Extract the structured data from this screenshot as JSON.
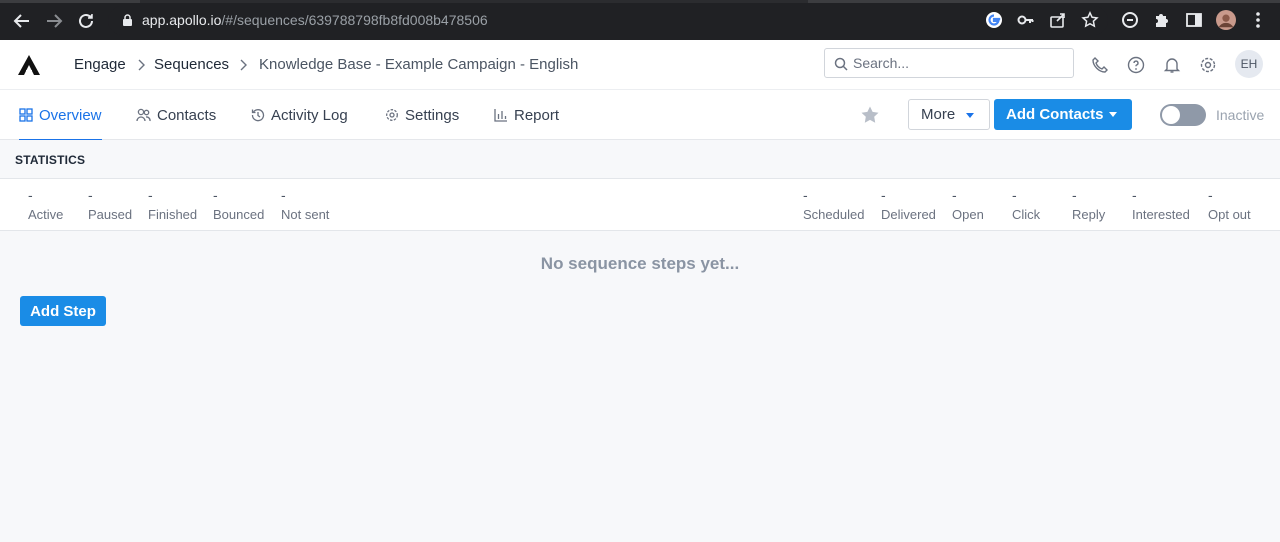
{
  "browser": {
    "url_host": "app.apollo.io",
    "url_path": "/#/sequences/639788798fb8fd008b478506"
  },
  "header": {
    "breadcrumb": [
      "Engage",
      "Sequences",
      "Knowledge Base - Example Campaign - English"
    ],
    "search_placeholder": "Search...",
    "avatar_initials": "EH"
  },
  "tabs": [
    {
      "label": "Overview",
      "icon": "grid-icon"
    },
    {
      "label": "Contacts",
      "icon": "people-icon"
    },
    {
      "label": "Activity Log",
      "icon": "history-icon"
    },
    {
      "label": "Settings",
      "icon": "gear-icon"
    },
    {
      "label": "Report",
      "icon": "bar-chart-icon"
    }
  ],
  "actions": {
    "more_label": "More",
    "add_contacts_label": "Add Contacts",
    "toggle_label": "Inactive"
  },
  "statistics": {
    "title": "STATISTICS",
    "left": [
      {
        "value": "-",
        "label": "Active"
      },
      {
        "value": "-",
        "label": "Paused"
      },
      {
        "value": "-",
        "label": "Finished"
      },
      {
        "value": "-",
        "label": "Bounced"
      },
      {
        "value": "-",
        "label": "Not sent"
      }
    ],
    "right": [
      {
        "value": "-",
        "label": "Scheduled"
      },
      {
        "value": "-",
        "label": "Delivered"
      },
      {
        "value": "-",
        "label": "Open"
      },
      {
        "value": "-",
        "label": "Click"
      },
      {
        "value": "-",
        "label": "Reply"
      },
      {
        "value": "-",
        "label": "Interested"
      },
      {
        "value": "-",
        "label": "Opt out"
      }
    ]
  },
  "content": {
    "empty_message": "No sequence steps yet...",
    "add_step_label": "Add Step"
  },
  "colors": {
    "accent": "#1a73e8",
    "primary_button": "#1a8ce6"
  }
}
